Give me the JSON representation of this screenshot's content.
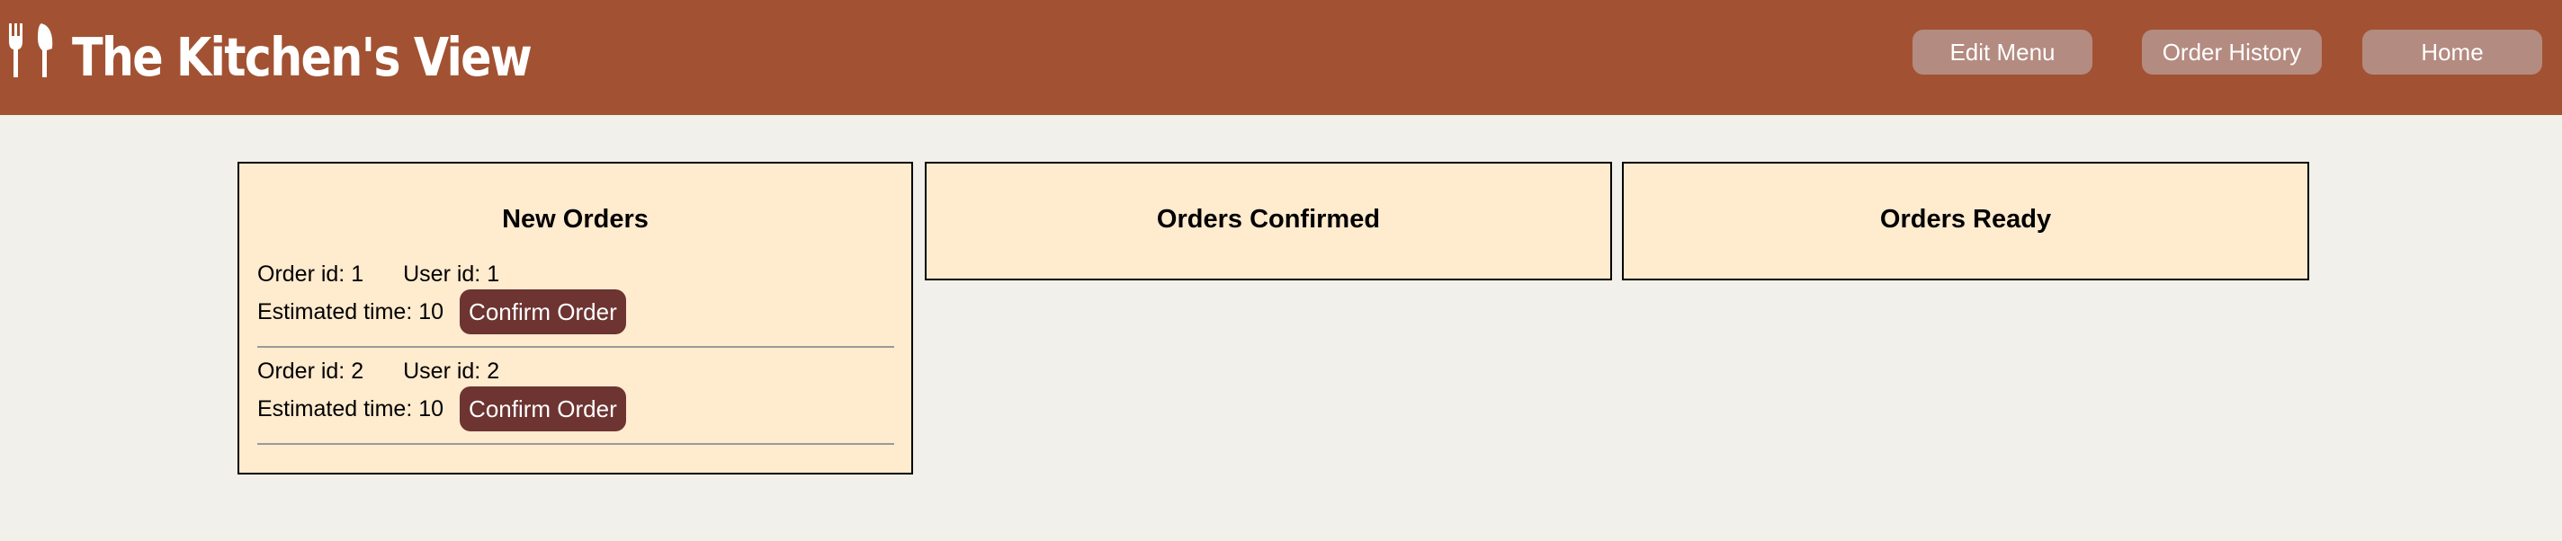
{
  "header": {
    "title": "The Kitchen's View",
    "logo_icon": "fork-knife-icon",
    "nav": {
      "edit_menu": "Edit Menu",
      "order_history": "Order History",
      "home": "Home"
    }
  },
  "columns": {
    "new_orders": {
      "title": "New Orders",
      "orders": [
        {
          "order_label": "Order id: ",
          "order_id": "1",
          "user_label": "User id: ",
          "user_id": "1",
          "time_label": "Estimated time: ",
          "time": "10",
          "button": "Confirm Order"
        },
        {
          "order_label": "Order id: ",
          "order_id": "2",
          "user_label": "User id: ",
          "user_id": "2",
          "time_label": "Estimated time: ",
          "time": "10",
          "button": "Confirm Order"
        }
      ]
    },
    "orders_confirmed": {
      "title": "Orders Confirmed"
    },
    "orders_ready": {
      "title": "Orders Ready"
    }
  },
  "colors": {
    "header_bg": "#a25232",
    "nav_button_bg": "#b48b80",
    "confirm_button_bg": "#6d3432",
    "column_bg": "#ffebce",
    "page_bg": "#f2f0ea"
  }
}
